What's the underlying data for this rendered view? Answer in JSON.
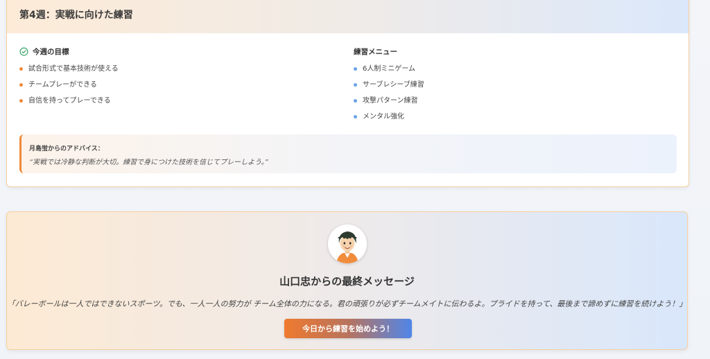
{
  "week": {
    "title": "第4週：実戦に向けた練習",
    "goals_title": "今週の目標",
    "goals": [
      "試合形式で基本技術が使える",
      "チームプレーができる",
      "自信を持ってプレーできる"
    ],
    "menu_title": "練習メニュー",
    "menu": [
      "6人制ミニゲーム",
      "サーブレシーブ練習",
      "攻撃パターン練習",
      "メンタル強化"
    ],
    "advice_label": "月島蛍からのアドバイス：",
    "advice_text": "“実戦では冷静な判断が大切。練習で身につけた技術を信じてプレーしよう。”"
  },
  "final": {
    "title": "山口忠からの最終メッセージ",
    "message": "「バレーボールは一人ではできないスポーツ。でも、一人一人の努力が チーム全体の力になる。君の頑張りが必ずチームメイトに伝わるよ。プライドを持って、最後まで諦めずに練習を続けよう！」",
    "button_label": "今日から練習を始めよう！"
  },
  "icons": {
    "goals": "check-circle-icon",
    "avatar": "character-avatar-icon"
  },
  "colors": {
    "accent_orange": "#ef8a3a",
    "accent_blue": "#6aa2e6",
    "check_green": "#3fa66b"
  }
}
